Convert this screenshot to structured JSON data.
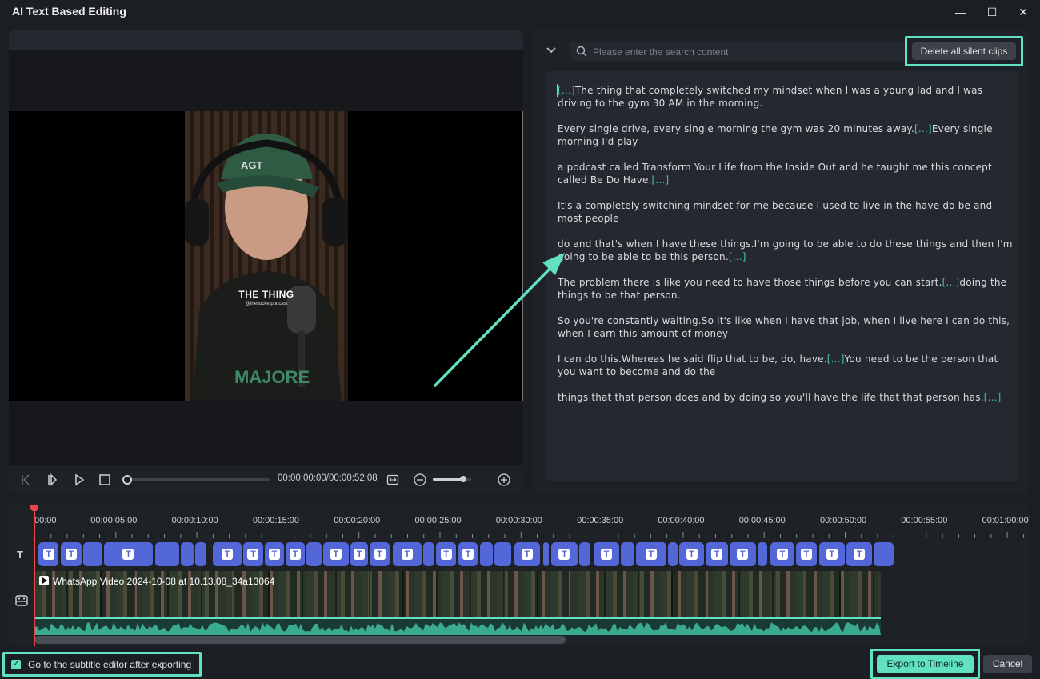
{
  "window": {
    "title": "AI Text Based Editing",
    "minimize_glyph": "—",
    "maximize_glyph": "☐",
    "close_glyph": "✕"
  },
  "preview": {
    "caption_text": "THE THING",
    "caption_handle": "@thesocketpodcast",
    "cap_text": "AGT",
    "shirt_text": "MAJORE",
    "timecode": "00:00:00:00/00:00:52:08",
    "playback_progress": 0,
    "zoom_level": 0.8
  },
  "transcript": {
    "search_placeholder": "Please enter the search content",
    "delete_button_label": "Delete all silent clips",
    "paragraphs": [
      {
        "parts": [
          {
            "t": "[...]",
            "silent": true
          },
          {
            "t": "The thing that completely switched my mindset when I was a young lad and I was driving to the gym 30 AM in the morning."
          }
        ]
      },
      {
        "parts": [
          {
            "t": "Every single drive, every single morning the gym was 20 minutes away."
          },
          {
            "t": "[...]",
            "silent": true
          },
          {
            "t": "Every single morning I'd play"
          }
        ]
      },
      {
        "parts": [
          {
            "t": "a podcast called Transform Your Life from the Inside Out and he taught me this concept called Be Do Have."
          },
          {
            "t": "[...]",
            "silent": true
          }
        ]
      },
      {
        "parts": [
          {
            "t": "It's a completely switching mindset for me because I used to live in the have do be and most people"
          }
        ]
      },
      {
        "parts": [
          {
            "t": " do and that's when I have these things.I'm going to be able to do these things and then I'm going to be able to be this person."
          },
          {
            "t": "[...]",
            "silent": true
          }
        ]
      },
      {
        "parts": [
          {
            "t": "The problem there is like you need to have those things before you can start."
          },
          {
            "t": "[...]",
            "silent": true
          },
          {
            "t": "doing the things to be that person."
          }
        ]
      },
      {
        "parts": [
          {
            "t": "So you're constantly waiting.So it's like when I have that job, when I live here I can do this, when I earn this amount of money"
          }
        ]
      },
      {
        "parts": [
          {
            "t": " I can do this.Whereas he said flip that to be, do, have."
          },
          {
            "t": "[...]",
            "silent": true
          },
          {
            "t": "You need to be the person that you want to become and do the"
          }
        ]
      },
      {
        "parts": [
          {
            "t": " things that that person does and by doing so you'll have the life that that person has."
          },
          {
            "t": "[...]",
            "silent": true
          }
        ]
      }
    ]
  },
  "timeline": {
    "ruler_labels": [
      "00:00",
      "00:00:05:00",
      "00:00:10:00",
      "00:00:15:00",
      "00:00:20:00",
      "00:00:25:00",
      "00:00:30:00",
      "00:00:35:00",
      "00:00:40:00",
      "00:00:45:00",
      "00:00:50:00",
      "00:00:55:00",
      "00:01:00:00"
    ],
    "text_track_icon": "T",
    "video_clip_label": "WhatsApp Video 2024-10-08 at 10.13.08_34a13064",
    "text_segments": [
      {
        "t": 0.25,
        "d": 1.25,
        "mark": true
      },
      {
        "t": 1.65,
        "d": 1.25,
        "mark": true
      },
      {
        "t": 3.0,
        "d": 1.2,
        "mark": false
      },
      {
        "t": 4.3,
        "d": 3.0,
        "mark": true
      },
      {
        "t": 7.45,
        "d": 1.5,
        "mark": false
      },
      {
        "t": 9.05,
        "d": 0.75,
        "mark": false
      },
      {
        "t": 9.9,
        "d": 0.7,
        "mark": false
      },
      {
        "t": 11.0,
        "d": 1.8,
        "mark": true
      },
      {
        "t": 12.9,
        "d": 1.2,
        "mark": true
      },
      {
        "t": 14.2,
        "d": 1.2,
        "mark": true
      },
      {
        "t": 15.5,
        "d": 1.2,
        "mark": true
      },
      {
        "t": 16.8,
        "d": 0.9,
        "mark": false
      },
      {
        "t": 17.8,
        "d": 1.6,
        "mark": true
      },
      {
        "t": 19.5,
        "d": 1.1,
        "mark": true
      },
      {
        "t": 20.7,
        "d": 1.2,
        "mark": true
      },
      {
        "t": 22.1,
        "d": 1.8,
        "mark": true
      },
      {
        "t": 24.0,
        "d": 0.7,
        "mark": false
      },
      {
        "t": 24.8,
        "d": 1.2,
        "mark": true
      },
      {
        "t": 26.15,
        "d": 1.2,
        "mark": true
      },
      {
        "t": 27.5,
        "d": 0.8,
        "mark": false
      },
      {
        "t": 28.4,
        "d": 1.0,
        "mark": false
      },
      {
        "t": 29.6,
        "d": 1.6,
        "mark": true
      },
      {
        "t": 31.4,
        "d": 0.35,
        "mark": false
      },
      {
        "t": 31.9,
        "d": 1.6,
        "mark": true
      },
      {
        "t": 33.6,
        "d": 0.7,
        "mark": false
      },
      {
        "t": 34.5,
        "d": 1.6,
        "mark": true
      },
      {
        "t": 36.2,
        "d": 0.8,
        "mark": false
      },
      {
        "t": 37.1,
        "d": 1.9,
        "mark": true
      },
      {
        "t": 39.1,
        "d": 0.6,
        "mark": false
      },
      {
        "t": 39.8,
        "d": 1.5,
        "mark": true
      },
      {
        "t": 41.4,
        "d": 1.4,
        "mark": true
      },
      {
        "t": 42.9,
        "d": 1.6,
        "mark": true
      },
      {
        "t": 44.6,
        "d": 0.6,
        "mark": false
      },
      {
        "t": 45.4,
        "d": 1.5,
        "mark": true
      },
      {
        "t": 47.0,
        "d": 1.25,
        "mark": true
      },
      {
        "t": 48.4,
        "d": 1.6,
        "mark": true
      },
      {
        "t": 50.1,
        "d": 1.6,
        "mark": true
      },
      {
        "t": 51.8,
        "d": 1.2,
        "mark": false
      }
    ],
    "duration_seconds": 52.3
  },
  "footer": {
    "checkbox_label": "Go to the subtitle editor after exporting",
    "checkbox_checked": true,
    "export_label": "Export to Timeline",
    "cancel_label": "Cancel"
  },
  "colors": {
    "accent": "#5fe1c2",
    "subtitle_clip": "#5467d8",
    "playhead": "#e8464a"
  }
}
